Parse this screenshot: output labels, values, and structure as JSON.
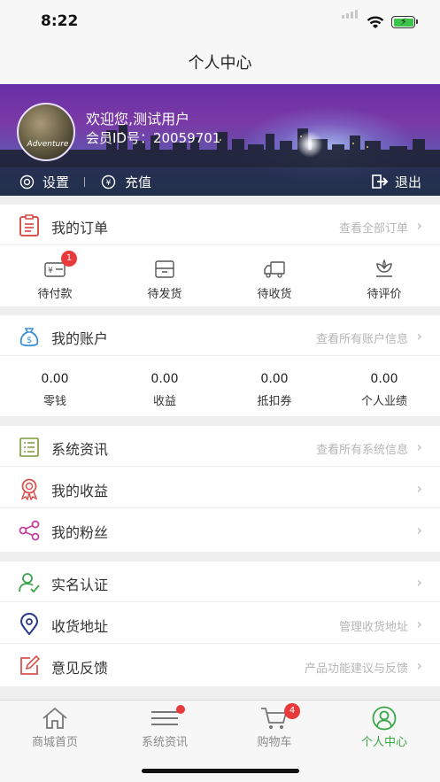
{
  "status_bar": {
    "time": "8:22"
  },
  "nav": {
    "title": "个人中心"
  },
  "profile": {
    "welcome": "欢迎您,测试用户",
    "member_id": "会员ID号：20059701",
    "avatar_text": "Adventure"
  },
  "profile_actions": {
    "settings": "设置",
    "recharge": "充值",
    "logout": "退出"
  },
  "orders": {
    "title": "我的订单",
    "view_all": "查看全部订单",
    "items": [
      {
        "label": "待付款",
        "badge": "1"
      },
      {
        "label": "待发货"
      },
      {
        "label": "待收货"
      },
      {
        "label": "待评价"
      }
    ]
  },
  "account": {
    "title": "我的账户",
    "view_all": "查看所有账户信息",
    "items": [
      {
        "value": "0.00",
        "label": "零钱"
      },
      {
        "value": "0.00",
        "label": "收益"
      },
      {
        "value": "0.00",
        "label": "抵扣券"
      },
      {
        "value": "0.00",
        "label": "个人业绩"
      }
    ]
  },
  "menu1": {
    "news": {
      "label": "系统资讯",
      "right": "查看所有系统信息"
    },
    "earnings": {
      "label": "我的收益"
    },
    "fans": {
      "label": "我的粉丝"
    }
  },
  "menu2": {
    "verify": {
      "label": "实名认证"
    },
    "address": {
      "label": "收货地址",
      "right": "管理收货地址"
    },
    "feedback": {
      "label": "意见反馈",
      "right": "产品功能建议与反馈"
    }
  },
  "tabbar": {
    "items": [
      {
        "label": "商城首页"
      },
      {
        "label": "系统资讯"
      },
      {
        "label": "购物车",
        "badge": "4"
      },
      {
        "label": "个人中心"
      }
    ]
  },
  "colors": {
    "accent": "#3aa64a",
    "badge": "#e83a3a",
    "icon_red": "#d9534f"
  }
}
